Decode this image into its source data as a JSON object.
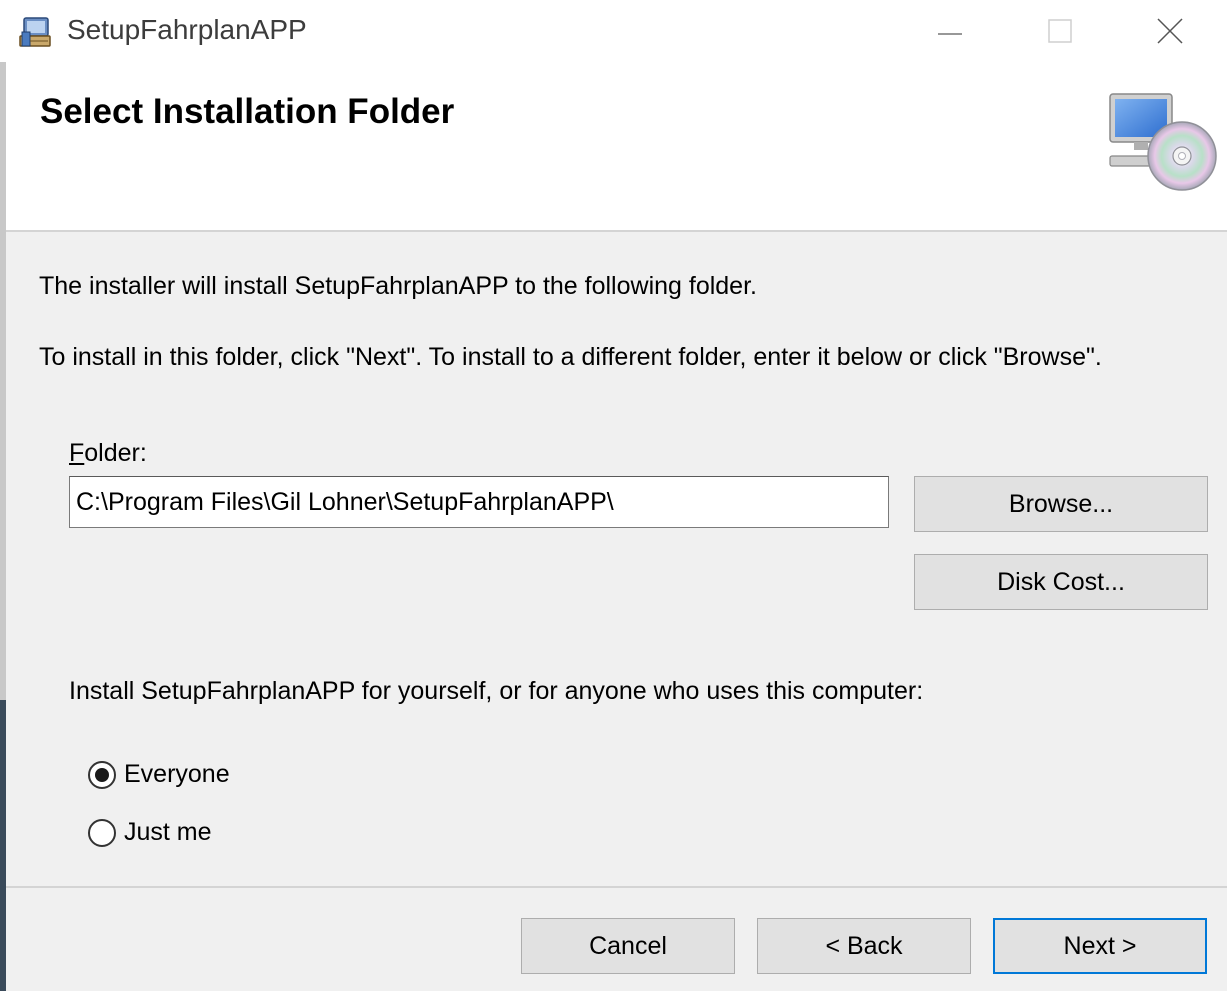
{
  "window": {
    "title": "SetupFahrplanAPP",
    "controls": {
      "minimize": "minimize-icon",
      "maximize": "maximize-icon",
      "close": "close-icon"
    }
  },
  "banner": {
    "title": "Select Installation Folder",
    "icon": "computer-disc-icon"
  },
  "body": {
    "intro_line1": "The installer will install SetupFahrplanAPP to the following folder.",
    "intro_line2": "To install in this folder, click \"Next\". To install to a different folder, enter it below or click \"Browse\".",
    "folder_label_accel": "F",
    "folder_label_rest": "older:",
    "folder_value": "C:\\Program Files\\Gil Lohner\\SetupFahrplanAPP\\",
    "browse_label": "Browse...",
    "disk_cost_label": "Disk Cost...",
    "who_label": "Install SetupFahrplanAPP for yourself, or for anyone who uses this computer:",
    "options": [
      {
        "label": "Everyone",
        "selected": true
      },
      {
        "label": "Just me",
        "selected": false
      }
    ]
  },
  "footer": {
    "cancel_label": "Cancel",
    "back_label": "< Back",
    "next_label": "Next >"
  },
  "colors": {
    "accent": "#0078d7",
    "window_bg": "#f0f0f0",
    "button_bg": "#e1e1e1"
  }
}
